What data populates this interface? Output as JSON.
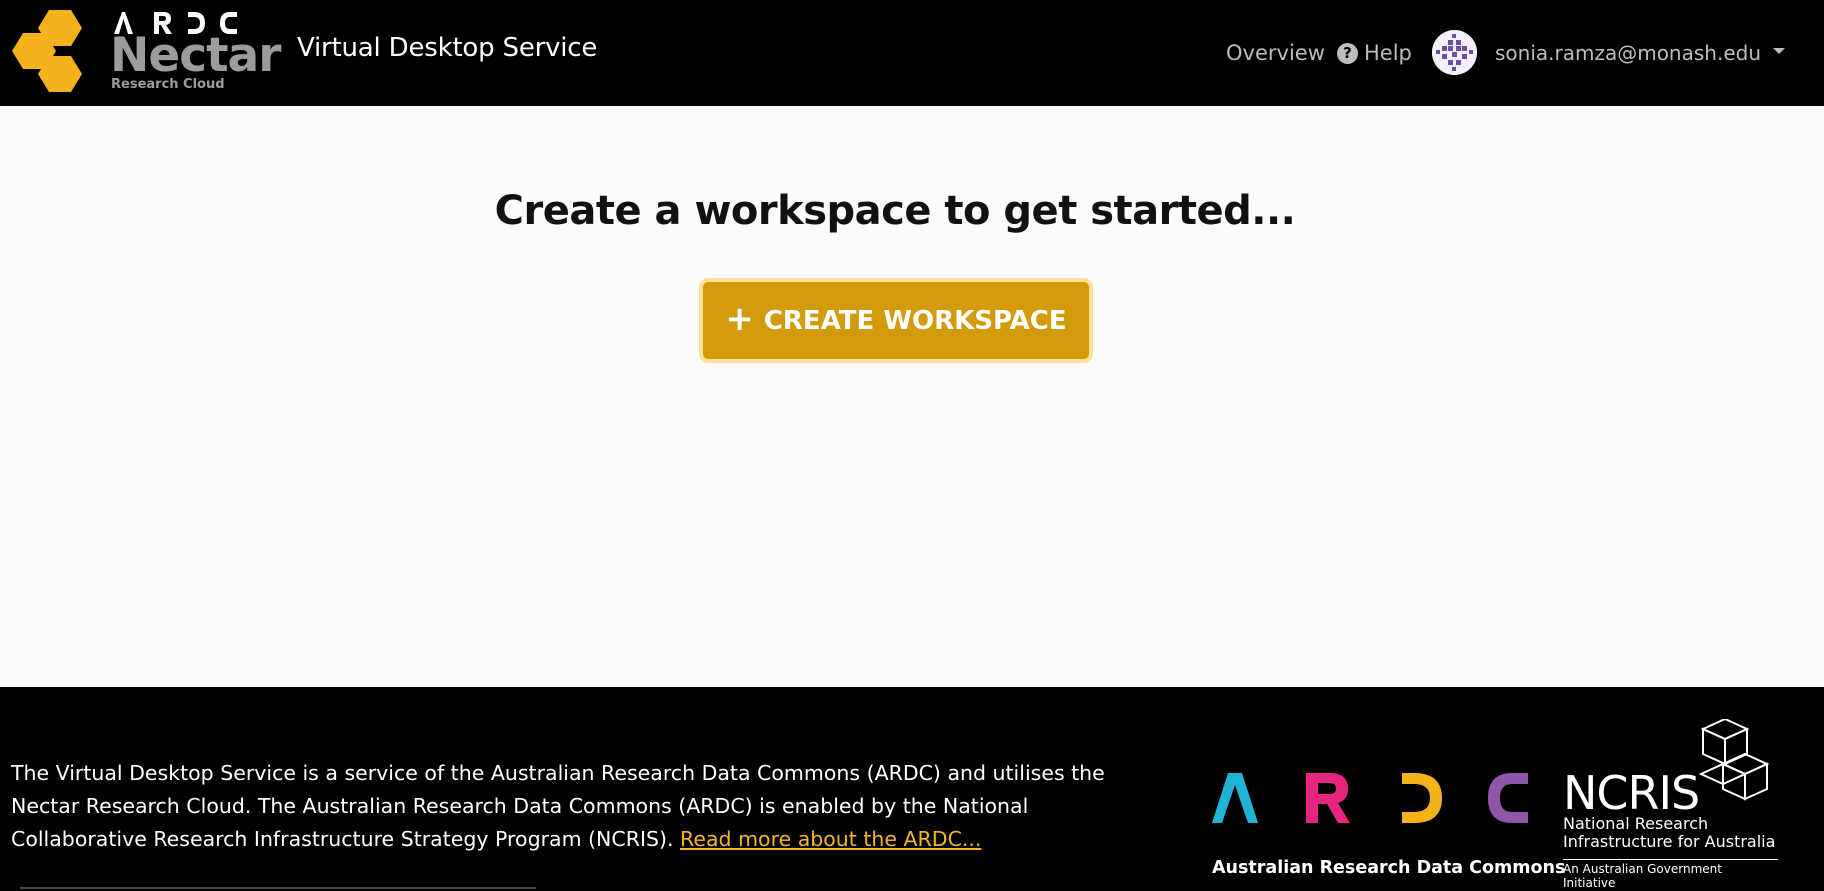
{
  "header": {
    "brand": {
      "top_letters": [
        "A",
        "R",
        "D",
        "C"
      ],
      "name": "Nectar",
      "tagline": "Research Cloud",
      "hex_color": "#f6b21c"
    },
    "app_title": "Virtual Desktop Service",
    "nav": {
      "overview_label": "Overview",
      "help_label": "Help"
    },
    "user": {
      "email": "sonia.ramza@monash.edu"
    }
  },
  "main": {
    "headline": "Create a workspace to get started...",
    "create_button_label": "CREATE WORKSPACE",
    "accent_color": "#d39a0c"
  },
  "footer": {
    "description": "The Virtual Desktop Service is a service of the Australian Research Data Commons (ARDC) and utilises the Nectar Research Cloud. The Australian Research Data Commons (ARDC) is enabled by the National Collaborative Research Infrastructure Strategy Program (NCRIS).",
    "read_more_label": "Read more about the ARDC...",
    "ardc_logo": {
      "letters": [
        "A",
        "R",
        "D",
        "C"
      ],
      "colors": [
        "#1fb3d6",
        "#e5257e",
        "#f4b31b",
        "#8e56a8"
      ],
      "caption": "Australian Research Data Commons"
    },
    "ncris_logo": {
      "word": "NCRIS",
      "subtitle_line1": "National Research",
      "subtitle_line2": "Infrastructure for Australia",
      "gov_line": "An Australian Government Initiative"
    }
  }
}
